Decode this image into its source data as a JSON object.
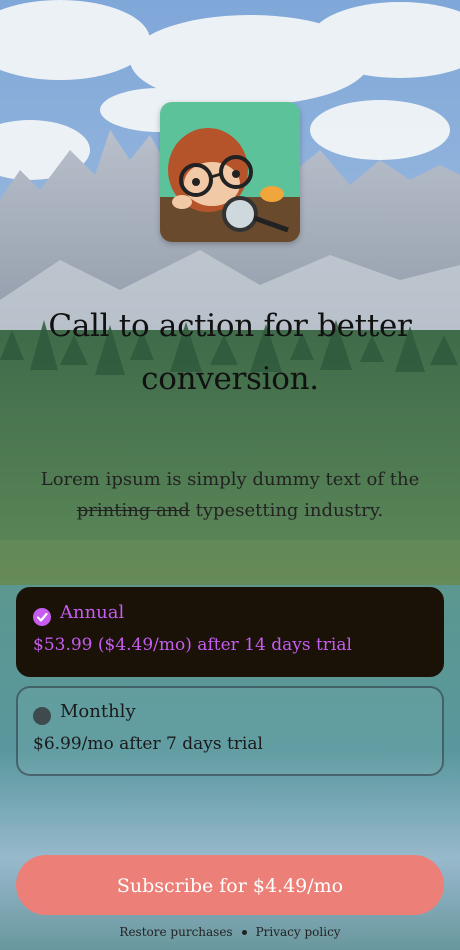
{
  "hero": {
    "headline": "Call to action for better conversion.",
    "body_prefix": "Lorem ipsum is simply dummy text of the ",
    "body_strike": "printing and",
    "body_suffix": " typesetting industry."
  },
  "plans": [
    {
      "name": "Annual",
      "price": "$53.99 ($4.49/mo) after 14 days trial",
      "selected": true
    },
    {
      "name": "Monthly",
      "price": "$6.99/mo after 7 days trial",
      "selected": false
    }
  ],
  "cta": {
    "label": "Subscribe for $4.49/mo"
  },
  "footer": {
    "restore": "Restore purchases",
    "privacy": "Privacy policy"
  },
  "colors": {
    "accent": "#c65cf0",
    "cta": "#ec8078",
    "selected_card": "#1a1207"
  }
}
